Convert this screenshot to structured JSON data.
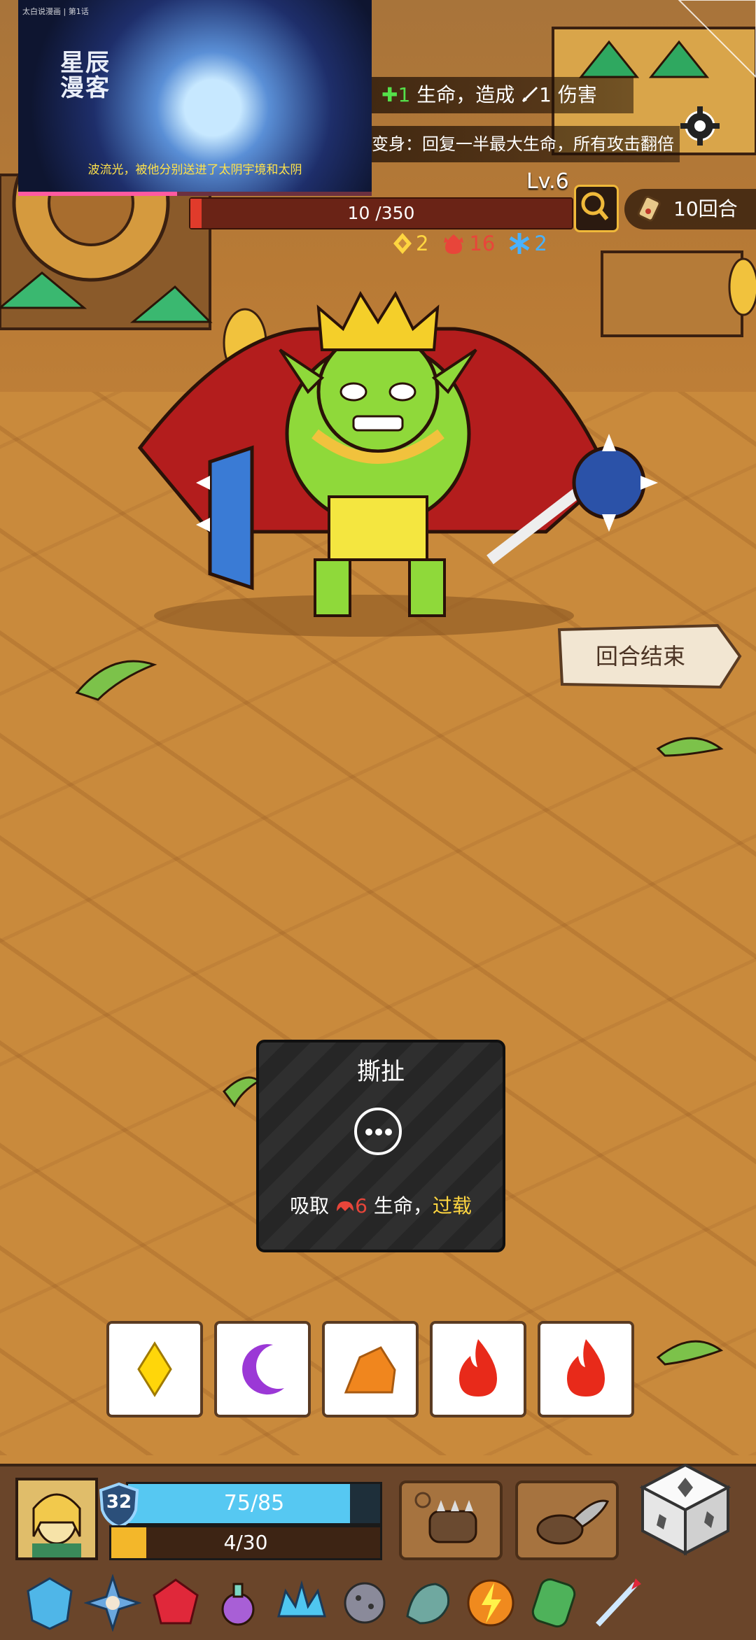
{
  "video": {
    "title": "星辰漫客",
    "subtitle": "波流光，被他分别送进了太阴宇境和太阴",
    "tag": "太白说漫画 | 第1话"
  },
  "enemy_intents": [
    {
      "plus": "✚",
      "num": "1",
      "text1": "生命，造成",
      "dmg": "1",
      "text2": "伤害"
    },
    {
      "text": "变身：回复一半最大生命，所有攻击翻倍"
    }
  ],
  "enemy": {
    "level": "Lv.6",
    "hp_text": "10 /350",
    "hp_fraction": 0.03,
    "status": [
      {
        "icon": "dodge-icon",
        "value": "2",
        "color": "#ffd640"
      },
      {
        "icon": "rage-icon",
        "value": "16",
        "color": "#e8453a"
      },
      {
        "icon": "frost-icon",
        "value": "2",
        "color": "#48b2ff"
      }
    ]
  },
  "turns": "10回合",
  "end_turn_label": "回合结束",
  "skill_card": {
    "title": "撕扯",
    "desc_prefix": "吸取",
    "desc_value": "6",
    "desc_mid": "生命，",
    "desc_keyword": "过载"
  },
  "dice": [
    {
      "shape": "diamond",
      "color": "#ffd60a"
    },
    {
      "shape": "moon",
      "color": "#9b38d6"
    },
    {
      "shape": "rock",
      "color": "#f0861e"
    },
    {
      "shape": "flame",
      "color": "#e82a1a"
    },
    {
      "shape": "flame",
      "color": "#e82a1a"
    }
  ],
  "player": {
    "armor": "32",
    "hp_text": "75/85",
    "hp_fraction": 0.88,
    "exp_text": "4/30",
    "exp_fraction": 0.13
  },
  "relics": [
    "ice-gem-icon",
    "compass-star-icon",
    "ruby-icon",
    "potion-icon",
    "crystal-crown-icon",
    "spiked-ball-icon",
    "dragon-head-icon",
    "lightning-orb-icon",
    "green-stone-icon",
    "crossbow-bolt-icon"
  ],
  "colors": {
    "hp_red": "#e03b2b",
    "hp_blue": "#56c8f2",
    "exp_yellow": "#f3b72a",
    "accent_gold": "#f0b93a"
  }
}
